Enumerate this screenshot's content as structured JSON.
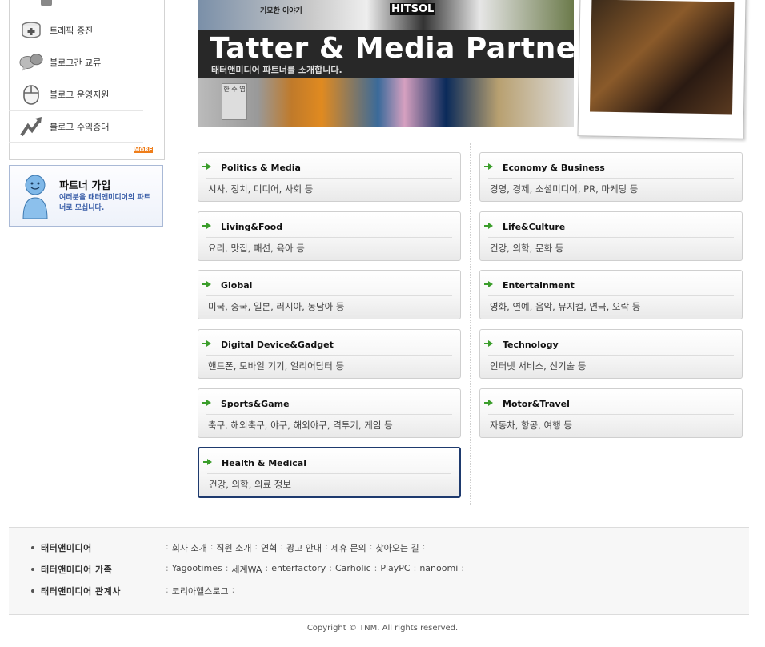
{
  "sidebar": {
    "items": [
      {
        "label": "트래픽 증진",
        "icon": "database-plus-icon"
      },
      {
        "label": "블로그간 교류",
        "icon": "chat-bubbles-icon"
      },
      {
        "label": "블로그 운영지원",
        "icon": "mouse-icon"
      },
      {
        "label": "블로그 수익증대",
        "icon": "rising-chart-icon"
      }
    ],
    "more_label": "MORE",
    "partner": {
      "title": "파트너 가입",
      "desc": "여러분을 태터앤미디어의 파트너로 모십니다.",
      "icon": "person-icon"
    }
  },
  "banner": {
    "title": "Tatter & Media Partners",
    "subtitle": "태터앤미디어 파트너를 소개합니다.",
    "tiles": [
      "기묘한 이야기",
      "HITSOL",
      "한 주 엽"
    ]
  },
  "categories": {
    "left": [
      {
        "title": "Politics & Media",
        "desc": "시사, 정치, 미디어, 사회 등"
      },
      {
        "title": "Living&Food",
        "desc": "요리, 맛집, 패션, 육아 등"
      },
      {
        "title": "Global",
        "desc": "미국, 중국, 일본, 러시아, 동남아 등"
      },
      {
        "title": "Digital Device&Gadget",
        "desc": "핸드폰, 모바일 기기, 얼리어답터 등"
      },
      {
        "title": "Sports&Game",
        "desc": "축구, 해외축구, 야구, 해외야구, 격투기, 게임 등"
      },
      {
        "title": "Health & Medical",
        "desc": "건강, 의학, 의료 정보"
      }
    ],
    "right": [
      {
        "title": "Economy & Business",
        "desc": "경영, 경제, 소셜미디어, PR, 마케팅 등"
      },
      {
        "title": "Life&Culture",
        "desc": "건강, 의학, 문화 등"
      },
      {
        "title": "Entertainment",
        "desc": "영화, 연예, 음악, 뮤지컬, 연극, 오락 등"
      },
      {
        "title": "Technology",
        "desc": "인터넷 서비스, 신기술 등"
      },
      {
        "title": "Motor&Travel",
        "desc": "자동차, 항공, 여행 등"
      }
    ]
  },
  "footer": {
    "rows": [
      {
        "head": "태터앤미디어",
        "links": [
          "회사 소개",
          "직원 소개",
          "연혁",
          "광고 안내",
          "제휴 문의",
          "찾아오는 길"
        ]
      },
      {
        "head": "태터앤미디어 가족",
        "links": [
          "Yagootimes",
          "세계WA",
          "enterfactory",
          "Carholic",
          "PlayPC",
          "nanoomi"
        ]
      },
      {
        "head": "태터앤미디어 관계사",
        "links": [
          "코리아헬스로그"
        ]
      }
    ],
    "separator": ":",
    "copyright": "Copyright © TNM. All rights reserved."
  },
  "colors": {
    "arrow": "#3a9d2a",
    "selected_border": "#1e3a6e",
    "partner_text": "#3a5ea8",
    "more_badge": "#ef7e1b"
  }
}
